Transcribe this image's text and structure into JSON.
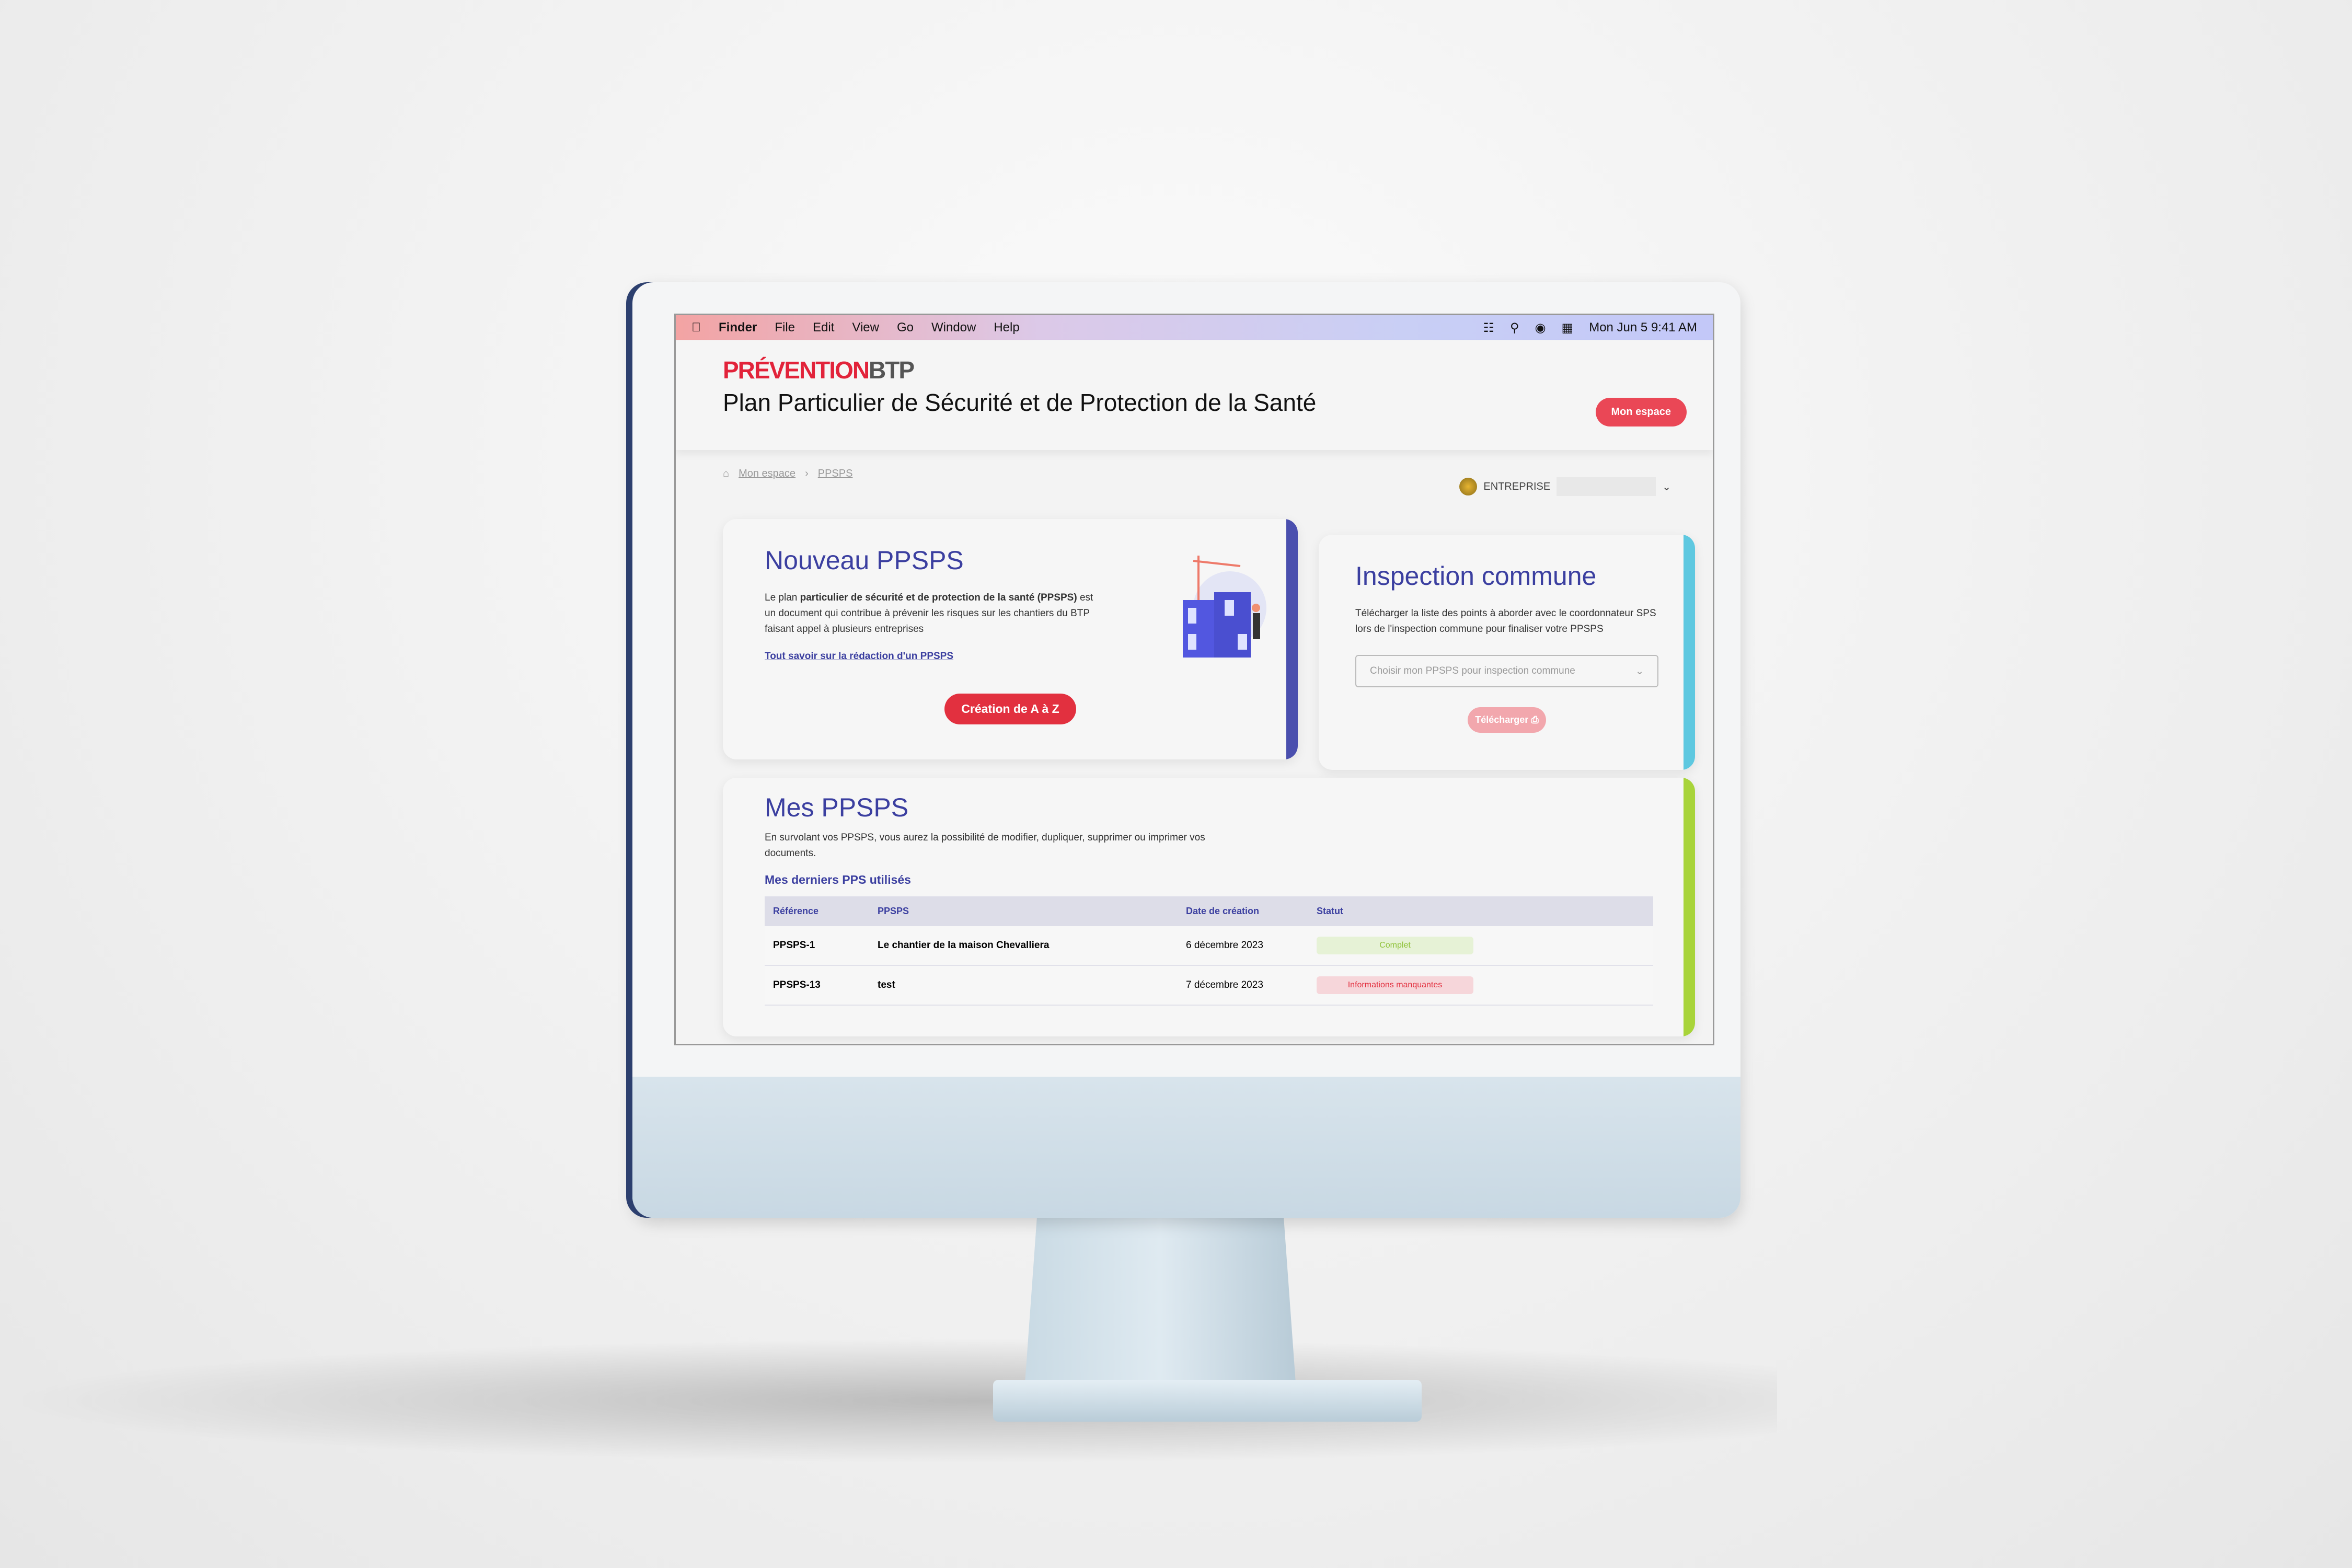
{
  "menubar": {
    "items": [
      "Finder",
      "File",
      "Edit",
      "View",
      "Go",
      "Window",
      "Help"
    ],
    "clock": "Mon Jun 5  9:41 AM",
    "icons": [
      "wifi-icon",
      "search-icon",
      "user-icon",
      "control-center-icon"
    ]
  },
  "header": {
    "logo_a": "PRÉVENTION",
    "logo_b": "BTP",
    "title": "Plan Particulier de Sécurité et de Protection de la Santé",
    "account_button": "Mon espace"
  },
  "breadcrumb": [
    "Mon espace",
    "PPSPS"
  ],
  "entreprise": {
    "label": "ENTREPRISE"
  },
  "nouveau": {
    "title": "Nouveau PPSPS",
    "text_a": "Le plan ",
    "text_b": "particulier de sécurité et de protection de la santé (PPSPS)",
    "text_c": " est un document qui contribue à prévenir les risques sur les chantiers du BTP faisant appel à plusieurs entreprises",
    "link": "Tout savoir sur la rédaction d'un PPSPS",
    "button": "Création de A à Z",
    "accent": "#4a4fae"
  },
  "inspection": {
    "title": "Inspection commune",
    "text": "Télécharger la liste des points à aborder avec le coordonnateur SPS lors de l'inspection commune pour finaliser votre PPSPS",
    "select_placeholder": "Choisir mon PPSPS pour inspection commune",
    "button": "Télécharger",
    "accent": "#5ec8e0"
  },
  "mes": {
    "title": "Mes PPSPS",
    "text": "En survolant vos PPSPS, vous aurez la possibilité de modifier, dupliquer, supprimer ou imprimer vos documents.",
    "subtitle": "Mes derniers PPS utilisés",
    "accent": "#a8d43a",
    "columns": [
      "Référence",
      "PPSPS",
      "Date de création",
      "Statut"
    ],
    "rows": [
      {
        "ref": "PPSPS-1",
        "name": "Le chantier de la maison Chevalliera",
        "date": "6 décembre 2023",
        "status": "Complet",
        "status_kind": "ok"
      },
      {
        "ref": "PPSPS-13",
        "name": "test",
        "date": "7 décembre 2023",
        "status": "Informations manquantes",
        "status_kind": "missing"
      }
    ]
  }
}
